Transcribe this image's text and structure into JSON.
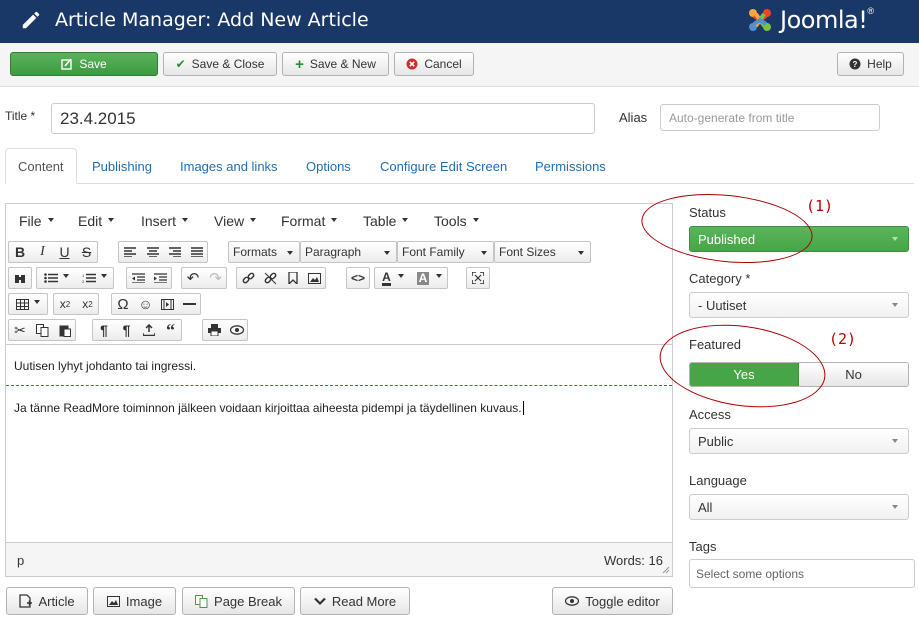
{
  "header": {
    "title": "Article Manager: Add New Article",
    "logo_text": "Joomla!",
    "logo_reg": "®"
  },
  "toolbar": {
    "save": "Save",
    "save_close": "Save & Close",
    "save_new": "Save & New",
    "cancel": "Cancel",
    "help": "Help"
  },
  "title_field": {
    "label": "Title *",
    "value": "23.4.2015"
  },
  "alias_field": {
    "label": "Alias",
    "placeholder": "Auto-generate from title"
  },
  "tabs": [
    {
      "label": "Content",
      "active": true
    },
    {
      "label": "Publishing"
    },
    {
      "label": "Images and links"
    },
    {
      "label": "Options"
    },
    {
      "label": "Configure Edit Screen"
    },
    {
      "label": "Permissions"
    }
  ],
  "editor": {
    "menus": [
      "File",
      "Edit",
      "Insert",
      "View",
      "Format",
      "Table",
      "Tools"
    ],
    "dropdowns": [
      "Formats",
      "Paragraph",
      "Font Family",
      "Font Sizes"
    ],
    "intro_text": "Uutisen lyhyt johdanto tai ingressi.",
    "body_text": "Ja tänne ReadMore toiminnon jälkeen voidaan kirjoittaa aiheesta pidempi ja täydellinen kuvaus.",
    "path": "p",
    "word_count": "Words: 16"
  },
  "editor_buttons": {
    "article": "Article",
    "image": "Image",
    "page_break": "Page Break",
    "read_more": "Read More",
    "toggle_editor": "Toggle editor"
  },
  "sidebar": {
    "status": {
      "label": "Status",
      "value": "Published"
    },
    "category": {
      "label": "Category *",
      "value": "- Uutiset"
    },
    "featured": {
      "label": "Featured",
      "yes": "Yes",
      "no": "No",
      "selected": "Yes"
    },
    "access": {
      "label": "Access",
      "value": "Public"
    },
    "language": {
      "label": "Language",
      "value": "All"
    },
    "tags": {
      "label": "Tags",
      "placeholder": "Select some options"
    }
  },
  "annotations": {
    "one": "(1)",
    "two": "(2)"
  },
  "colors": {
    "header_bg": "#1a3867",
    "success": "#46a546",
    "link": "#1f6fb5",
    "annotation": "#b00000"
  }
}
